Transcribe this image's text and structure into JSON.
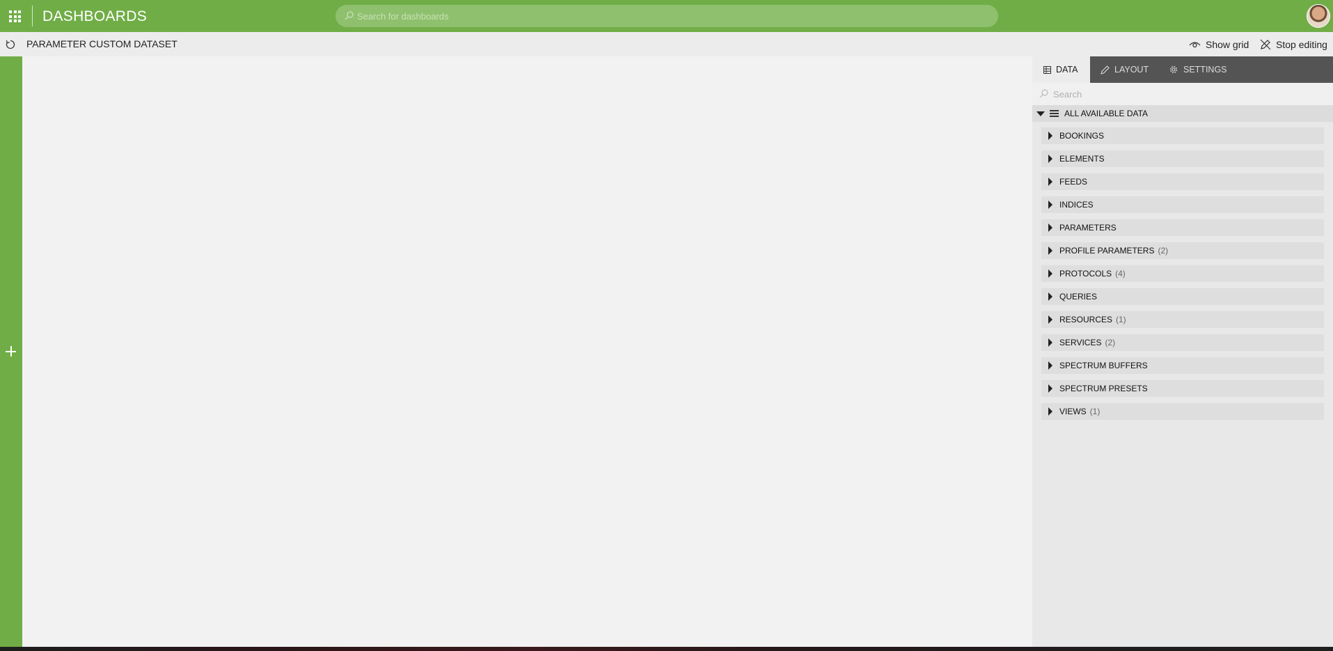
{
  "topbar": {
    "title": "DASHBOARDS",
    "search_placeholder": "Search for dashboards"
  },
  "subbar": {
    "dashboard_name": "PARAMETER CUSTOM DATASET",
    "show_grid_label": "Show grid",
    "stop_editing_label": "Stop editing"
  },
  "panel": {
    "tabs": [
      {
        "label": "DATA",
        "active": true
      },
      {
        "label": "LAYOUT",
        "active": false
      },
      {
        "label": "SETTINGS",
        "active": false
      }
    ],
    "search_placeholder": "Search",
    "all_data_label": "ALL AVAILABLE DATA",
    "items": [
      {
        "label": "BOOKINGS",
        "count": ""
      },
      {
        "label": "ELEMENTS",
        "count": ""
      },
      {
        "label": "FEEDS",
        "count": ""
      },
      {
        "label": "INDICES",
        "count": ""
      },
      {
        "label": "PARAMETERS",
        "count": ""
      },
      {
        "label": "PROFILE PARAMETERS",
        "count": "(2)"
      },
      {
        "label": "PROTOCOLS",
        "count": "(4)"
      },
      {
        "label": "QUERIES",
        "count": ""
      },
      {
        "label": "RESOURCES",
        "count": "(1)"
      },
      {
        "label": "SERVICES",
        "count": "(2)"
      },
      {
        "label": "SPECTRUM BUFFERS",
        "count": ""
      },
      {
        "label": "SPECTRUM PRESETS",
        "count": ""
      },
      {
        "label": "VIEWS",
        "count": "(1)"
      }
    ]
  },
  "colors": {
    "brand_green": "#70ad47",
    "tab_bar": "#545454",
    "panel_bg": "#e8e8e8",
    "canvas_bg": "#f2f2f2"
  },
  "icons": [
    "apps-grid-icon",
    "search-icon",
    "avatar",
    "refresh-icon",
    "eye-icon",
    "stop-editing-icon",
    "add-icon",
    "table-icon",
    "pencil-icon",
    "gear-icon",
    "caret-down-icon",
    "list-icon",
    "caret-right-icon"
  ]
}
